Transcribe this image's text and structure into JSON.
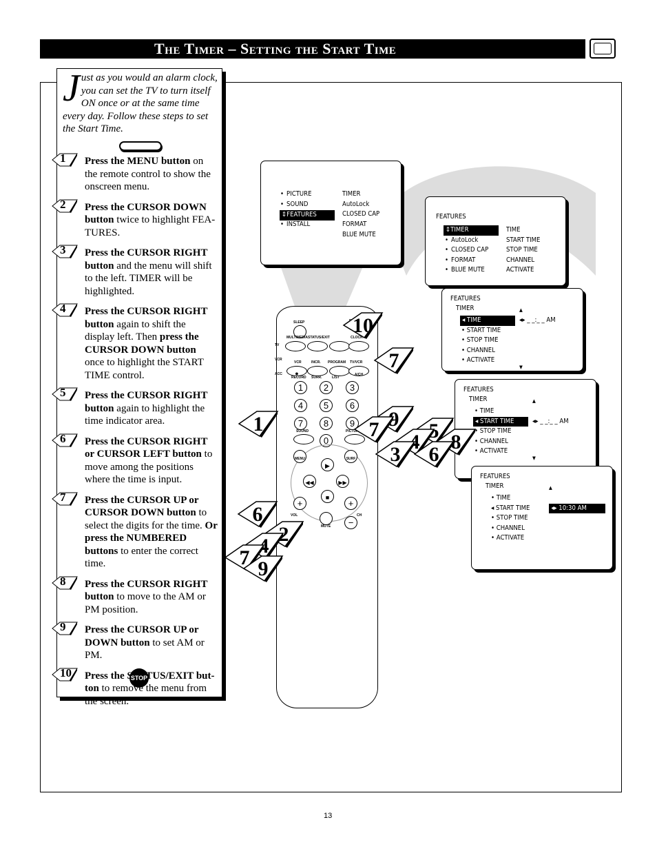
{
  "header": {
    "title": "The Timer – Setting the Start Time",
    "tv_icon": "tv-icon"
  },
  "intro": {
    "dropcap": "J",
    "text": "ust as you would an alarm clock, you can set the TV to turn itself ON once or at the same time every day. Follow these steps to set the Start Time."
  },
  "steps": [
    {
      "num": "1",
      "segs": [
        {
          "t": "Press the MENU button",
          "b": true
        },
        {
          "t": " on the remote control to show the onscreen menu.",
          "b": false
        }
      ]
    },
    {
      "num": "2",
      "segs": [
        {
          "t": "Press the CURSOR DOWN button",
          "b": true
        },
        {
          "t": " twice to highlight FEA-TURES.",
          "b": false
        }
      ]
    },
    {
      "num": "3",
      "segs": [
        {
          "t": "Press the CURSOR RIGHT button",
          "b": true
        },
        {
          "t": " and the menu will shift to the left. TIMER will be highlighted.",
          "b": false
        }
      ]
    },
    {
      "num": "4",
      "segs": [
        {
          "t": "Press the CURSOR RIGHT button",
          "b": true
        },
        {
          "t": " again to shift the display left. Then ",
          "b": false
        },
        {
          "t": "press the CURSOR DOWN button",
          "b": true
        },
        {
          "t": " once to highlight the START TIME control.",
          "b": false
        }
      ]
    },
    {
      "num": "5",
      "segs": [
        {
          "t": "Press the CURSOR RIGHT button",
          "b": true
        },
        {
          "t": " again to highlight the time indicator area.",
          "b": false
        }
      ]
    },
    {
      "num": "6",
      "segs": [
        {
          "t": "Press the CURSOR RIGHT or CURSOR LEFT button",
          "b": true
        },
        {
          "t": " to move among the positions where the time is input.",
          "b": false
        }
      ]
    },
    {
      "num": "7",
      "segs": [
        {
          "t": "Press the CURSOR UP or CURSOR DOWN button",
          "b": true
        },
        {
          "t": " to select the digits for the time. ",
          "b": false
        },
        {
          "t": "Or press the NUMBERED buttons",
          "b": true
        },
        {
          "t": " to enter the correct time.",
          "b": false
        }
      ]
    },
    {
      "num": "8",
      "segs": [
        {
          "t": "Press the CURSOR RIGHT button",
          "b": true
        },
        {
          "t": " to move to the AM or PM position.",
          "b": false
        }
      ]
    },
    {
      "num": "9",
      "segs": [
        {
          "t": "Press the CURSOR UP or DOWN button",
          "b": true
        },
        {
          "t": " to set AM or PM.",
          "b": false
        }
      ]
    },
    {
      "num": "10",
      "segs": [
        {
          "t": "Press the STATUS/EXIT but-ton",
          "b": true
        },
        {
          "t": " to remove the menu from the screen.",
          "b": false
        }
      ]
    }
  ],
  "stop_sign": "STOP",
  "screens": {
    "s1": {
      "left": [
        "PICTURE",
        "SOUND",
        "FEATURES",
        "INSTALL"
      ],
      "right": [
        "TIMER",
        "AutoLock",
        "CLOSED CAP",
        "FORMAT",
        "BLUE MUTE"
      ]
    },
    "s2": {
      "title": "FEATURES",
      "left": [
        "TIMER",
        "AutoLock",
        "CLOSED CAP",
        "FORMAT",
        "BLUE MUTE"
      ],
      "right": [
        "TIME",
        "START TIME",
        "STOP TIME",
        "CHANNEL",
        "ACTIVATE"
      ]
    },
    "s3": {
      "title": "FEATURES",
      "sub": "TIMER",
      "items": [
        "TIME",
        "START TIME",
        "STOP TIME",
        "CHANNEL",
        "ACTIVATE"
      ],
      "value": "_ _:_ _ AM"
    },
    "s4": {
      "title": "FEATURES",
      "sub": "TIMER",
      "items": [
        "TIME",
        "START TIME",
        "STOP TIME",
        "CHANNEL",
        "ACTIVATE"
      ],
      "value": "_ _:_ _ AM"
    },
    "s5": {
      "title": "FEATURES",
      "sub": "TIMER",
      "items": [
        "TIME",
        "START TIME",
        "STOP TIME",
        "CHANNEL",
        "ACTIVATE"
      ],
      "value": "10:30 AM"
    }
  },
  "remote": {
    "sleep": "SLEEP",
    "power": "POWER",
    "multimedia": "MULTIMEDIA",
    "status_exit": "STATUS/EXIT",
    "clock": "CLOCK",
    "vcr": "VCR",
    "incr": "INCR.",
    "program": "PROGRAM",
    "tvvcr": "TV/VCR",
    "ach": "A/CH",
    "record": "RECORD",
    "surr": "SURR.",
    "list": "LIST",
    "tv": "TV",
    "vcr_side": "VCR",
    "acc": "ACC",
    "digits": [
      "1",
      "2",
      "3",
      "4",
      "5",
      "6",
      "7",
      "8",
      "9",
      "0"
    ],
    "sound": "SOUND",
    "picture": "PICTURE",
    "menu": "MENU",
    "surf": "SURF",
    "vol": "VOL",
    "ch": "CH",
    "mute": "MUTE"
  },
  "callouts": [
    "10",
    "7",
    "1",
    "9",
    "7",
    "5",
    "4",
    "8",
    "3",
    "6",
    "6",
    "2",
    "4",
    "7",
    "9"
  ],
  "page_number": "13"
}
